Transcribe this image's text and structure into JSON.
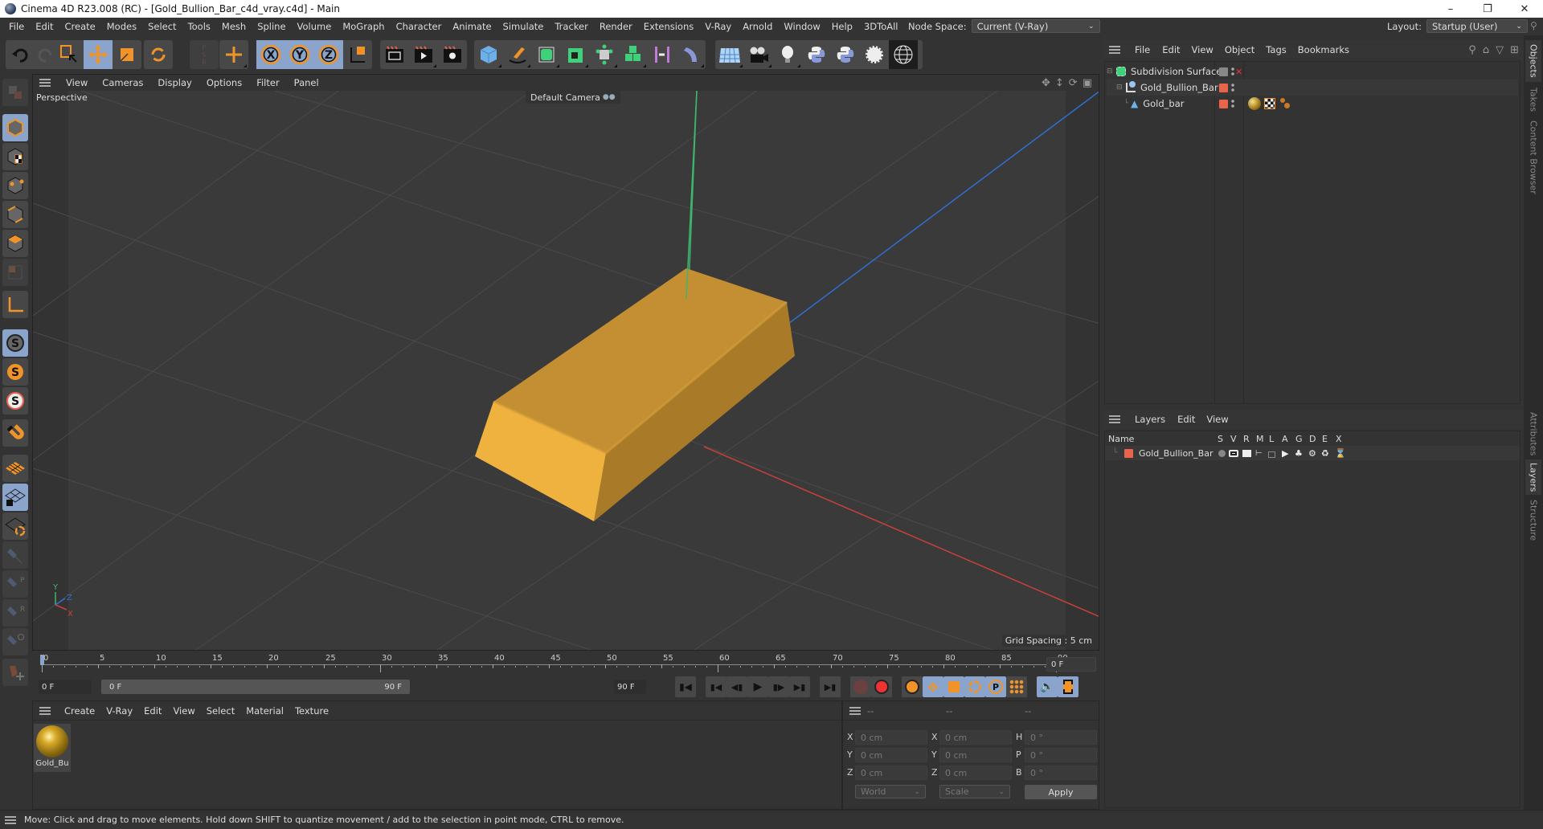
{
  "window": {
    "title": "Cinema 4D R23.008 (RC) - [Gold_Bullion_Bar_c4d_vray.c4d] - Main",
    "controls": [
      "minimize",
      "restore",
      "close"
    ]
  },
  "menubar": {
    "items": [
      "File",
      "Edit",
      "Create",
      "Modes",
      "Select",
      "Tools",
      "Mesh",
      "Spline",
      "Volume",
      "MoGraph",
      "Character",
      "Animate",
      "Simulate",
      "Tracker",
      "Render",
      "Extensions",
      "V-Ray",
      "Arnold",
      "Window",
      "Help",
      "3DToAll"
    ],
    "node_space_label": "Node Space:",
    "node_space_value": "Current (V-Ray)",
    "layout_label": "Layout:",
    "layout_value": "Startup (User)"
  },
  "toolbar": {
    "groups": [
      [
        "undo-icon",
        "redo-icon"
      ],
      [
        "live-selection-icon",
        "move-icon",
        "scale-icon",
        "rotate-icon"
      ],
      [
        "psr-icon"
      ],
      [
        "transform-icon"
      ],
      [
        "x-axis-lock-icon",
        "y-axis-lock-icon",
        "z-axis-lock-icon",
        "coordinate-system-icon"
      ],
      [
        "render-view-icon",
        "render-to-picture-viewer-icon",
        "render-settings-icon"
      ],
      [
        "cube-icon",
        "pen-icon",
        "subdivision-icon",
        "extrude-icon",
        "cloner-icon",
        "mograph-icon",
        "symmetry-icon",
        "deformer-icon"
      ],
      [
        "floor-icon",
        "camera-icon",
        "light-icon",
        "python-icon",
        "python-icon-2",
        "gear-icon",
        "sphere-wireframe-icon"
      ]
    ],
    "active": [
      "move-icon",
      "x-axis-lock-icon",
      "y-axis-lock-icon",
      "z-axis-lock-icon"
    ]
  },
  "left_tools": [
    "make-editable",
    "model-mode",
    "texture-mode",
    "points-mode",
    "edges-mode",
    "polygons-mode",
    "uv-mode",
    "axis-mode",
    "snap-toggle",
    "snap-settings",
    "snap-workplane",
    "magnet",
    "workplane",
    "locked-workplane",
    "align-workplane",
    "pin-tool",
    "pin-p",
    "pin-r",
    "pin-target",
    "add-joint"
  ],
  "viewport": {
    "menu": [
      "View",
      "Cameras",
      "Display",
      "Options",
      "Filter",
      "Panel"
    ],
    "view_name": "Perspective",
    "camera": "Default Camera",
    "grid_spacing": "Grid Spacing : 5 cm",
    "axis_labels": {
      "y": "Y",
      "z": "Z",
      "x": "X"
    },
    "colors": {
      "gold_top": "#c38f32",
      "gold_front": "#f0b23e",
      "gold_side": "#a97b28",
      "x_axis": "#c8413c",
      "y_axis": "#3fb56e",
      "z_axis": "#2f6fd0",
      "background": "#3a3a3a",
      "grid": "#4a4a4a"
    }
  },
  "objects_manager": {
    "menu": [
      "File",
      "Edit",
      "View",
      "Object",
      "Tags",
      "Bookmarks"
    ],
    "rows": [
      {
        "name": "Subdivision Surface",
        "icon": "subdivision-icon",
        "indent": 0,
        "tags": []
      },
      {
        "name": "Gold_Bullion_Bar",
        "icon": "null-object-icon",
        "indent": 1,
        "tags": []
      },
      {
        "name": "Gold_bar",
        "icon": "polygon-object-icon",
        "indent": 2,
        "tags": [
          "material-tag-icon",
          "texture-tag-icon",
          "vray-tag-icon"
        ]
      }
    ]
  },
  "layers_manager": {
    "menu": [
      "Layers",
      "Edit",
      "View"
    ],
    "columns": [
      "Name",
      "S",
      "V",
      "R",
      "M",
      "L",
      "A",
      "G",
      "D",
      "E",
      "X"
    ],
    "rows": [
      {
        "name": "Gold_Bullion_Bar",
        "color": "#e9644a"
      }
    ]
  },
  "side_tabs": {
    "top": [
      "Objects",
      "Takes",
      "Content Browser"
    ],
    "bottom": [
      "Attributes",
      "Layers",
      "Structure"
    ],
    "active_top": "Objects",
    "active_bottom": "Layers"
  },
  "timeline": {
    "ticks": [
      "0",
      "5",
      "10",
      "15",
      "20",
      "25",
      "30",
      "35",
      "40",
      "45",
      "50",
      "55",
      "60",
      "65",
      "70",
      "75",
      "80",
      "85",
      "90"
    ],
    "current_frame": "0 F",
    "start_field": "0 F",
    "range_start": "0 F",
    "range_end": "90 F",
    "end_field": "90 F",
    "frame_field": "0 F"
  },
  "material_manager": {
    "menu": [
      "Create",
      "V-Ray",
      "Edit",
      "View",
      "Select",
      "Material",
      "Texture"
    ],
    "materials": [
      {
        "name": "Gold_Bu"
      }
    ]
  },
  "coordinates": {
    "headers": [
      "--",
      "--",
      "--"
    ],
    "rows": [
      {
        "l1": "X",
        "v1": "0 cm",
        "l2": "X",
        "v2": "0 cm",
        "l3": "H",
        "v3": "0 °"
      },
      {
        "l1": "Y",
        "v1": "0 cm",
        "l2": "Y",
        "v2": "0 cm",
        "l3": "P",
        "v3": "0 °"
      },
      {
        "l1": "Z",
        "v1": "0 cm",
        "l2": "Z",
        "v2": "0 cm",
        "l3": "B",
        "v3": "0 °"
      }
    ],
    "mode": "World",
    "transform": "Scale",
    "apply": "Apply"
  },
  "statusbar": {
    "text": "Move: Click and drag to move elements. Hold down SHIFT to quantize movement / add to the selection in point mode, CTRL to remove."
  }
}
